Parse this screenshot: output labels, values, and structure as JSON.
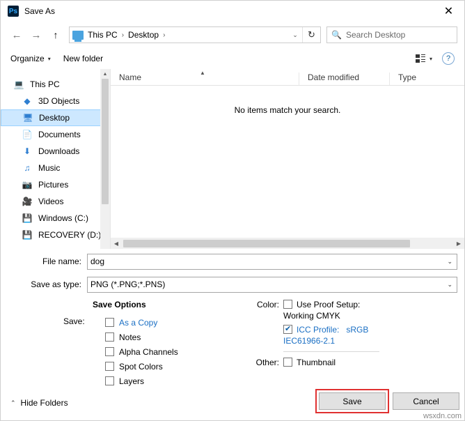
{
  "window": {
    "title": "Save As",
    "app_icon": "photoshop-icon",
    "close_label": "✕"
  },
  "nav": {
    "back_icon": "←",
    "forward_icon": "→",
    "up_icon": "↑",
    "breadcrumb": [
      "This PC",
      "Desktop"
    ],
    "breadcrumb_separator": "›",
    "dropdown_icon": "⌄",
    "refresh_icon": "↻",
    "search_placeholder": "Search Desktop",
    "search_value": "",
    "search_icon": "search-icon"
  },
  "commandbar": {
    "organize_label": "Organize",
    "organize_caret": "▾",
    "new_folder_label": "New folder",
    "view_caret": "▾",
    "help_label": "?"
  },
  "tree": {
    "items": [
      {
        "label": "This PC",
        "icon": "pc-icon",
        "level": 0,
        "selected": false
      },
      {
        "label": "3D Objects",
        "icon": "folder-3d-icon",
        "level": 1,
        "selected": false
      },
      {
        "label": "Desktop",
        "icon": "desktop-icon",
        "level": 1,
        "selected": true
      },
      {
        "label": "Documents",
        "icon": "documents-icon",
        "level": 1,
        "selected": false
      },
      {
        "label": "Downloads",
        "icon": "downloads-icon",
        "level": 1,
        "selected": false
      },
      {
        "label": "Music",
        "icon": "music-icon",
        "level": 1,
        "selected": false
      },
      {
        "label": "Pictures",
        "icon": "pictures-icon",
        "level": 1,
        "selected": false
      },
      {
        "label": "Videos",
        "icon": "videos-icon",
        "level": 1,
        "selected": false
      },
      {
        "label": "Windows (C:)",
        "icon": "drive-icon",
        "level": 1,
        "selected": false
      },
      {
        "label": "RECOVERY (D:)",
        "icon": "drive-icon",
        "level": 1,
        "selected": false
      }
    ],
    "scroll_up_icon": "▲",
    "scroll_down_icon": "▼"
  },
  "filelist": {
    "columns": [
      "Name",
      "Date modified",
      "Type"
    ],
    "sort_indicator": "▲",
    "empty_message": "No items match your search.",
    "rows": [],
    "hscroll_left_icon": "◀",
    "hscroll_right_icon": "▶"
  },
  "form": {
    "filename_label": "File name:",
    "filename_value": "dog",
    "filetype_label": "Save as type:",
    "filetype_value": "PNG (*.PNG;*.PNS)",
    "caret": "⌄"
  },
  "save_options": {
    "title": "Save Options",
    "save_label": "Save:",
    "left_checkboxes": [
      {
        "label": "As a Copy",
        "checked": false,
        "link": true
      },
      {
        "label": "Notes",
        "checked": false,
        "link": false
      },
      {
        "label": "Alpha Channels",
        "checked": false,
        "link": false
      },
      {
        "label": "Spot Colors",
        "checked": false,
        "link": false
      },
      {
        "label": "Layers",
        "checked": false,
        "link": false
      }
    ],
    "color_label": "Color:",
    "proof_setup": {
      "label": "Use Proof Setup:",
      "checked": false
    },
    "proof_setup_value": "Working CMYK",
    "icc_profile": {
      "label": "ICC Profile:",
      "checked": true
    },
    "icc_profile_value": "sRGB",
    "icc_profile_value2": "IEC61966-2.1",
    "other_label": "Other:",
    "thumbnail": {
      "label": "Thumbnail",
      "checked": false
    }
  },
  "footer": {
    "hide_folders_label": "Hide Folders",
    "hide_folders_caret": "⌃",
    "save_button": "Save",
    "cancel_button": "Cancel",
    "highlight_color": "#e03131",
    "watermark": "wsxdn.com"
  }
}
